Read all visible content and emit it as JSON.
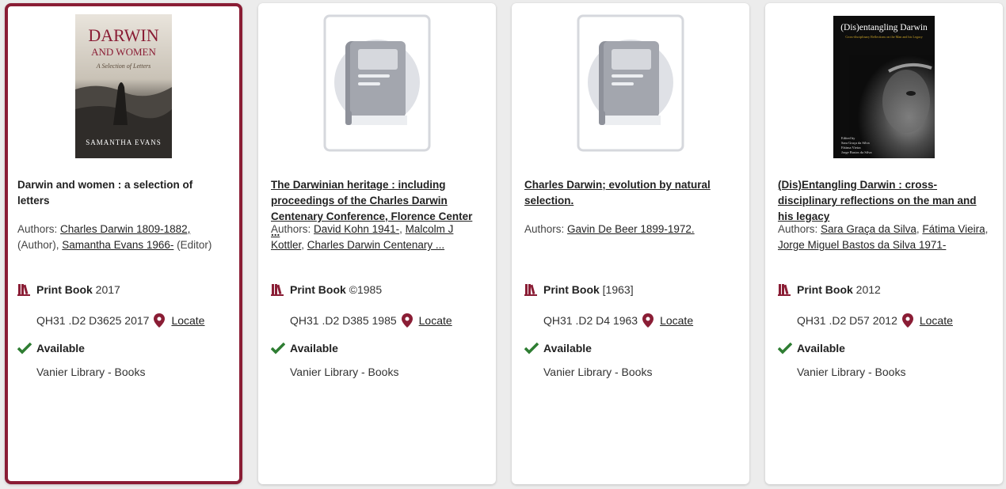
{
  "colors": {
    "accent": "#8a1d35",
    "available": "#2e7d32",
    "placeholder": "#a0a4ad"
  },
  "cards": [
    {
      "title": "Darwin and women : a selection of letters",
      "authors_prefix": "Authors:",
      "author1": "Charles Darwin 1809-1882,",
      "role1": "(Author),",
      "author2": "Samantha Evans 1966-",
      "role2": "(Editor)",
      "format": "Print Book",
      "year": "2017",
      "call_number": "QH31 .D2 D3625 2017",
      "locate": "Locate",
      "availability": "Available",
      "library": "Vanier Library - Books",
      "cover": {
        "title1": "DARWIN",
        "title2": "AND WOMEN",
        "subtitle": "A Selection of Letters",
        "author": "SAMANTHA EVANS"
      }
    },
    {
      "title": "The Darwinian heritage : including proceedings of the Charles Darwin Centenary Conference, Florence Center ...",
      "authors_prefix": "Authors:",
      "author1": "David Kohn 1941-",
      "author2": "Malcolm J Kottler",
      "author3": "Charles Darwin Centenary ...",
      "format": "Print Book",
      "year": "©1985",
      "call_number": "QH31 .D2 D385 1985",
      "locate": "Locate",
      "availability": "Available",
      "library": "Vanier Library - Books"
    },
    {
      "title": "Charles Darwin; evolution by natural selection.",
      "authors_prefix": "Authors:",
      "author1": "Gavin De Beer 1899-1972.",
      "format": "Print Book",
      "year": "[1963]",
      "call_number": "QH31 .D2 D4 1963",
      "locate": "Locate",
      "availability": "Available",
      "library": "Vanier Library - Books"
    },
    {
      "title": "(Dis)Entangling Darwin : cross-disciplinary reflections on the man and his legacy",
      "authors_prefix": "Authors:",
      "author1": "Sara Graça da Silva",
      "author2": "Fátima Vieira",
      "author3": "Jorge Miguel Bastos da Silva 1971-",
      "format": "Print Book",
      "year": "2012",
      "call_number": "QH31 .D2 D57 2012",
      "locate": "Locate",
      "availability": "Available",
      "library": "Vanier Library - Books",
      "cover": {
        "title": "(Dis)entangling Darwin",
        "subtitle": "Cross-disciplinary Reflections on the Man and his Legacy",
        "editors_label": "Edited by",
        "editor1": "Sara Graça da Silva",
        "editor2": "Fátima Vieira",
        "editor3": "Jorge Bastos da Silva"
      }
    }
  ]
}
